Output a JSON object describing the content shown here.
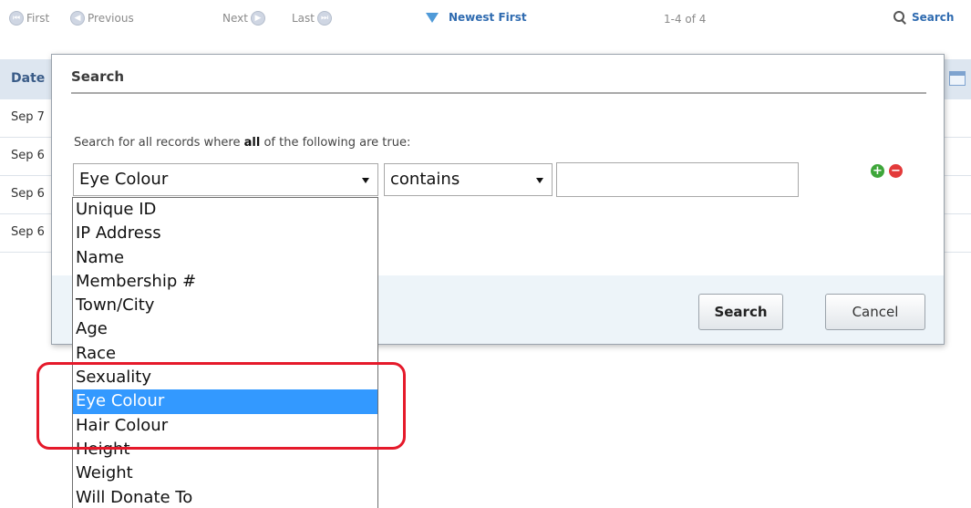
{
  "nav": {
    "first_label": "First",
    "previous_label": "Previous",
    "next_label": "Next",
    "last_label": "Last",
    "sort_label": "Newest First",
    "count_label": "1-4 of 4",
    "search_label": "Search"
  },
  "table": {
    "date_header": "Date",
    "rows": [
      "Sep 7",
      "Sep 6",
      "Sep 6",
      "Sep 6"
    ]
  },
  "modal": {
    "title": "Search",
    "instruction_pre": "Search for all records where ",
    "instruction_bold": "all",
    "instruction_post": " of the following are true:",
    "field_value": "Eye Colour",
    "operator_value": "contains",
    "value_input": "",
    "search_button": "Search",
    "cancel_button": "Cancel"
  },
  "dropdown": {
    "selected_index": 8,
    "options": [
      "Unique ID",
      "IP Address",
      "Name",
      "Membership #",
      "Town/City",
      "Age",
      "Race",
      "Sexuality",
      "Eye Colour",
      "Hair Colour",
      "Height",
      "Weight",
      "Will Donate To"
    ]
  },
  "colors": {
    "highlight": "#e5192a",
    "selected_option": "#3399ff",
    "link": "#2f6bb0"
  }
}
